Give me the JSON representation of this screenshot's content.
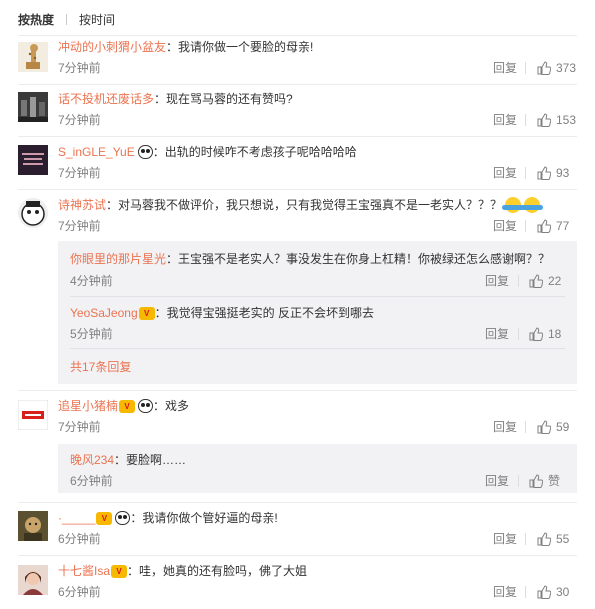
{
  "sort": {
    "hot": "按热度",
    "time": "按时间"
  },
  "reply_label": "回复",
  "colors": {
    "username": "#eb7350",
    "meta": "#808080",
    "subbox": "#f2f2f5",
    "badge": "#f7b900"
  },
  "comments": [
    {
      "user": "冲动的小刺猬小盆友",
      "text": "我请你做一个要脸的母亲!",
      "time": "7分钟前",
      "likes": "373"
    },
    {
      "user": "话不投机还废话多",
      "text": "现在骂马蓉的还有赞吗?",
      "time": "7分钟前",
      "likes": "153"
    },
    {
      "user": "S_inGLE_YuE",
      "text": "出轨的时候咋不考虑孩子呢哈哈哈哈",
      "time": "7分钟前",
      "likes": "93"
    },
    {
      "user": "诗神苏试",
      "text": "对马蓉我不做评价，我只想说，只有我觉得王宝强真不是一老实人？？？",
      "time": "7分钟前",
      "likes": "77",
      "replies": [
        {
          "user": "你眼里的那片星光",
          "text": "王宝强不是老实人？事没发生在你身上杠精！你被绿还怎么感谢啊？？",
          "time": "4分钟前",
          "likes": "22"
        },
        {
          "user": "YeoSaJeong",
          "text": "我觉得宝强挺老实的 反正不会坏到哪去",
          "time": "5分钟前",
          "likes": "18"
        }
      ],
      "more": "共17条回复"
    },
    {
      "user": "追星小猪楠",
      "text": "戏多",
      "time": "7分钟前",
      "likes": "59",
      "replies": [
        {
          "user": "晚风234",
          "text": "要脸啊……",
          "time": "6分钟前",
          "likes": "赞"
        }
      ]
    },
    {
      "user": "·_____",
      "text": "我请你做个管好逼的母亲!",
      "time": "6分钟前",
      "likes": "55"
    },
    {
      "user": "十七酱Isa",
      "text": "哇，她真的还有脸吗，佛了大姐",
      "time": "6分钟前",
      "likes": "30"
    }
  ]
}
